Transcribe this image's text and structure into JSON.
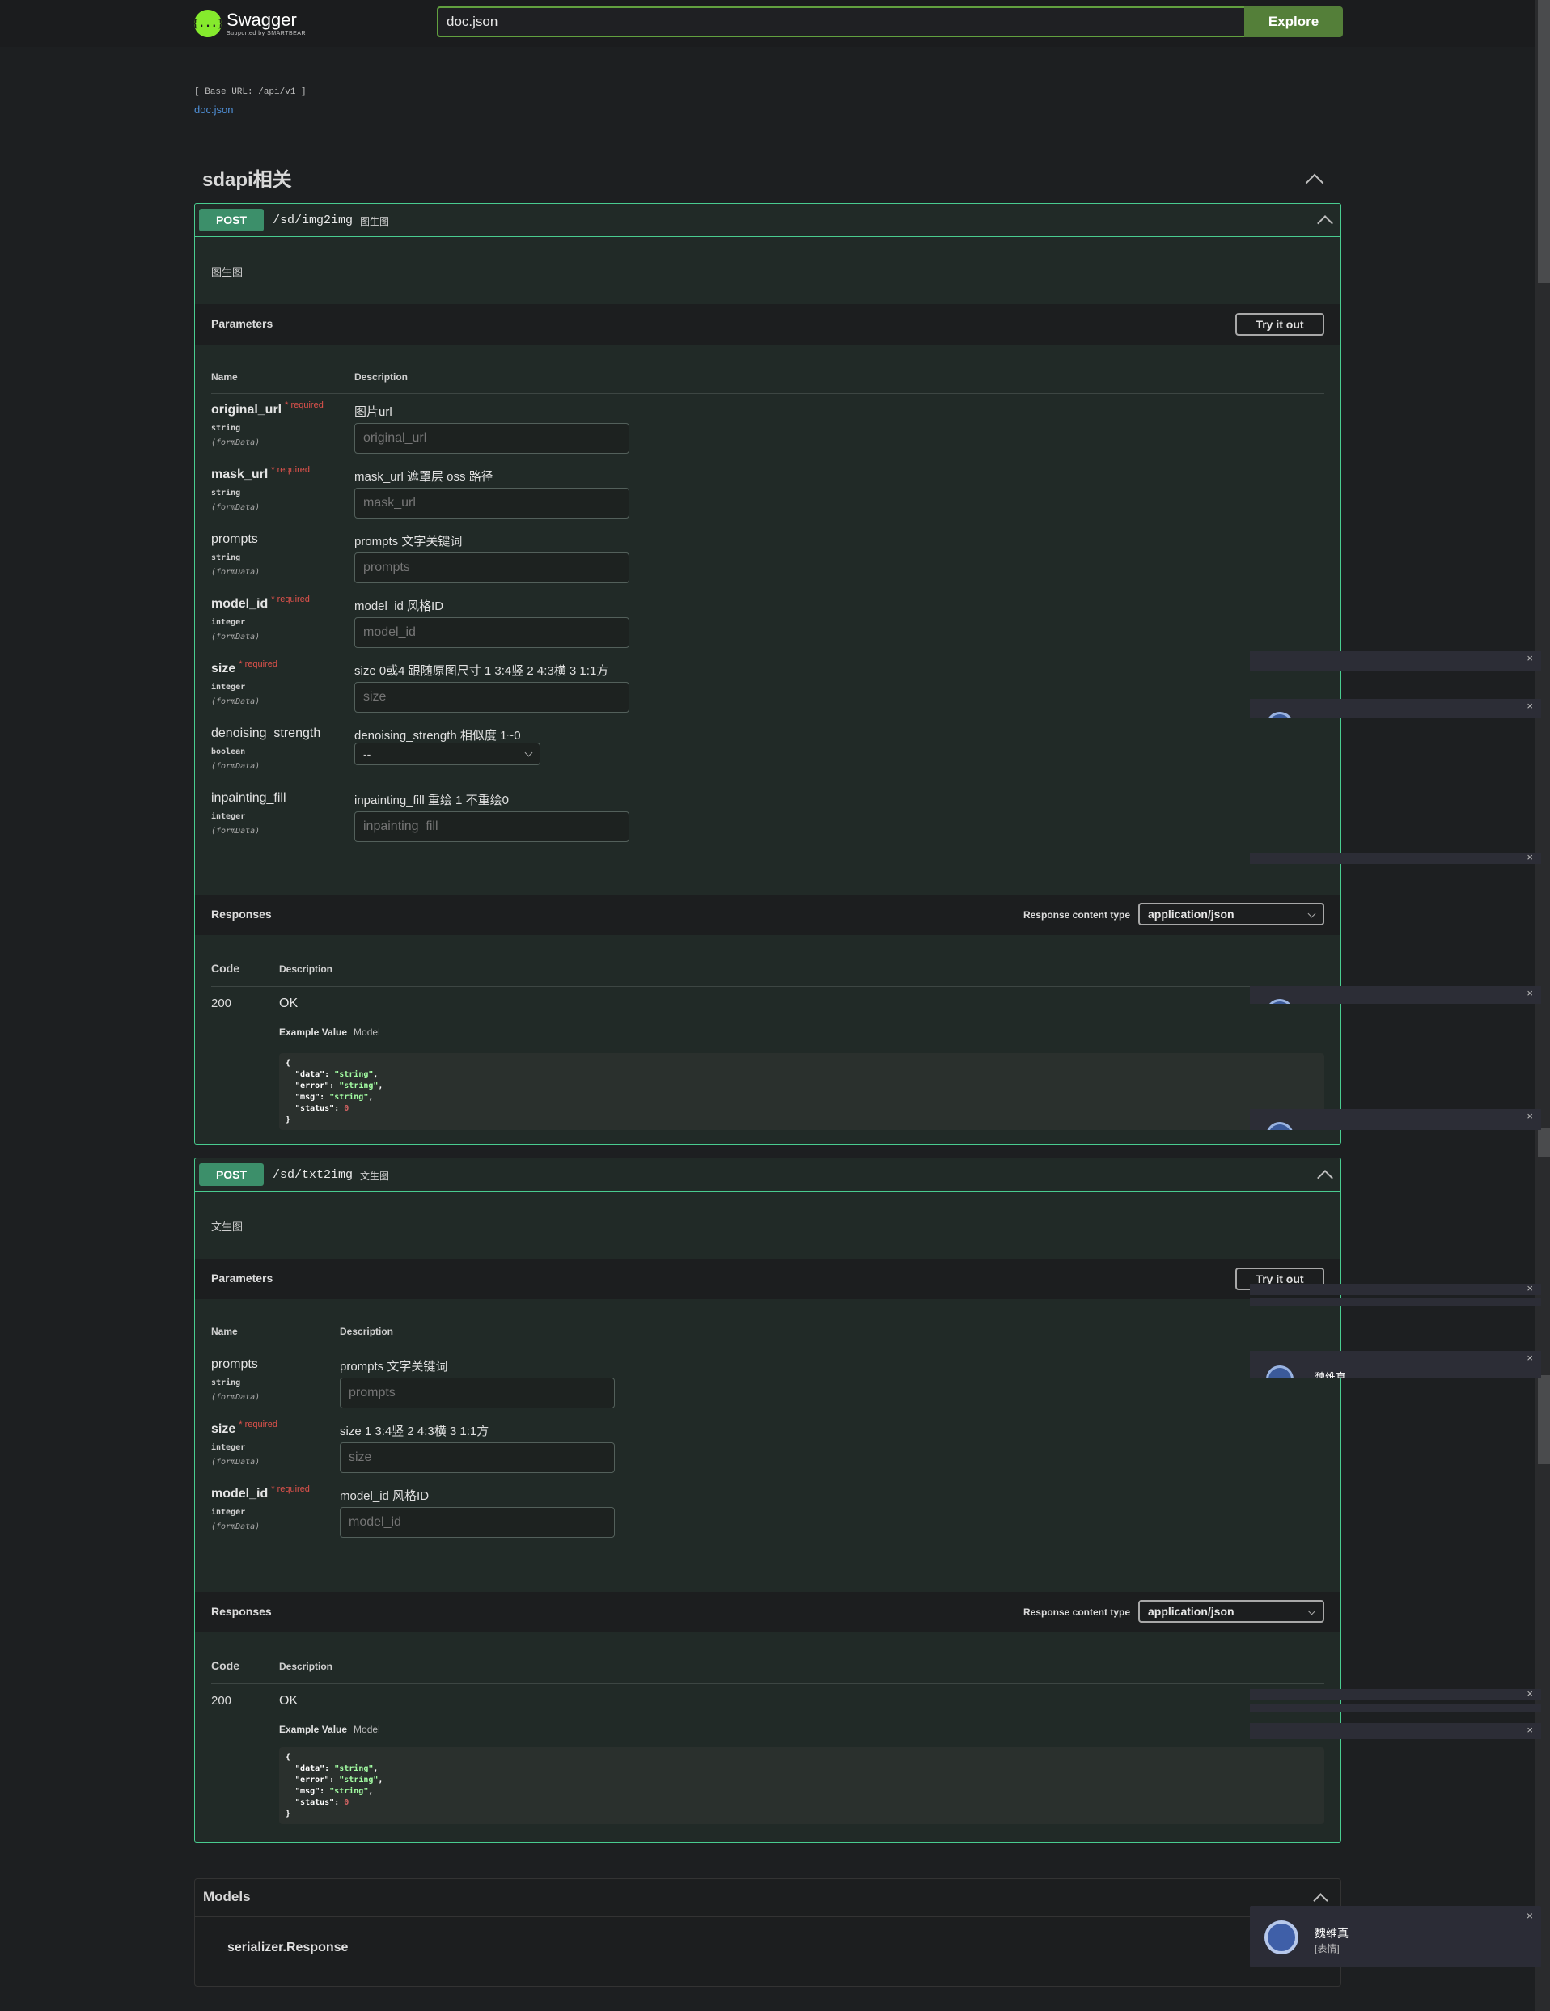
{
  "header": {
    "logo_title": "Swagger",
    "logo_sub": "Supported by SMARTBEAR",
    "logo_glyph": "{...}",
    "search_value": "doc.json",
    "explore_label": "Explore",
    "accent": "#85ea2d",
    "explore_color": "#547f39"
  },
  "info": {
    "base_url": "[ Base URL: /api/v1 ]",
    "doc_link": "doc.json"
  },
  "tag": {
    "title": "sdapi相关"
  },
  "operations": [
    {
      "method": "POST",
      "path": "/sd/img2img",
      "summary": "图生图",
      "description": "图生图",
      "params_title": "Parameters",
      "try_label": "Try it out",
      "col_name": "Name",
      "col_desc": "Description",
      "params": [
        {
          "name": "original_url",
          "required": "* required",
          "type": "string",
          "in": "(formData)",
          "desc": "图片url",
          "placeholder": "original_url"
        },
        {
          "name": "mask_url",
          "required": "* required",
          "type": "string",
          "in": "(formData)",
          "desc": "mask_url 遮罩层 oss 路径",
          "placeholder": "mask_url"
        },
        {
          "name": "prompts",
          "required": "",
          "type": "string",
          "in": "(formData)",
          "desc": "prompts 文字关键词",
          "placeholder": "prompts"
        },
        {
          "name": "model_id",
          "required": "* required",
          "type": "integer",
          "in": "(formData)",
          "desc": "model_id 风格ID",
          "placeholder": "model_id"
        },
        {
          "name": "size",
          "required": "* required",
          "type": "integer",
          "in": "(formData)",
          "desc": "size 0或4 跟随原图尺寸 1 3:4竖 2 4:3横 3 1:1方",
          "placeholder": "size"
        },
        {
          "name": "denoising_strength",
          "required": "",
          "type": "boolean",
          "in": "(formData)",
          "desc": "denoising_strength 相似度 1~0",
          "select": "--"
        },
        {
          "name": "inpainting_fill",
          "required": "",
          "type": "integer",
          "in": "(formData)",
          "desc": "inpainting_fill 重绘 1 不重绘0",
          "placeholder": "inpainting_fill"
        }
      ],
      "responses_title": "Responses",
      "resp_ct_label": "Response content type",
      "resp_ct": "application/json",
      "col_code": "Code",
      "resp_code": "200",
      "resp_desc": "OK",
      "ex_value": "Example Value",
      "ex_model": "Model"
    },
    {
      "method": "POST",
      "path": "/sd/txt2img",
      "summary": "文生图",
      "description": "文生图",
      "params_title": "Parameters",
      "try_label": "Try it out",
      "col_name": "Name",
      "col_desc": "Description",
      "params": [
        {
          "name": "prompts",
          "required": "",
          "type": "string",
          "in": "(formData)",
          "desc": "prompts 文字关键词",
          "placeholder": "prompts"
        },
        {
          "name": "size",
          "required": "* required",
          "type": "integer",
          "in": "(formData)",
          "desc": "size 1 3:4竖 2 4:3横 3 1:1方",
          "placeholder": "size"
        },
        {
          "name": "model_id",
          "required": "* required",
          "type": "integer",
          "in": "(formData)",
          "desc": "model_id 风格ID",
          "placeholder": "model_id"
        }
      ],
      "responses_title": "Responses",
      "resp_ct_label": "Response content type",
      "resp_ct": "application/json",
      "col_code": "Code",
      "resp_code": "200",
      "resp_desc": "OK",
      "ex_value": "Example Value",
      "ex_model": "Model"
    }
  ],
  "example_json": {
    "open": "{",
    "close": "}",
    "lines": [
      {
        "key": "\"data\"",
        "val": "\"string\"",
        "kind": "s",
        "sep": ","
      },
      {
        "key": "\"error\"",
        "val": "\"string\"",
        "kind": "s",
        "sep": ","
      },
      {
        "key": "\"msg\"",
        "val": "\"string\"",
        "kind": "s",
        "sep": ","
      },
      {
        "key": "\"status\"",
        "val": "0",
        "kind": "n",
        "sep": ""
      }
    ]
  },
  "models": {
    "title": "Models",
    "item": "serializer.Response"
  },
  "toast": {
    "name": "魏维真",
    "message": "[表情]",
    "close": "×"
  },
  "overlay_texts": {
    "partial_name_1": "魏维真"
  }
}
